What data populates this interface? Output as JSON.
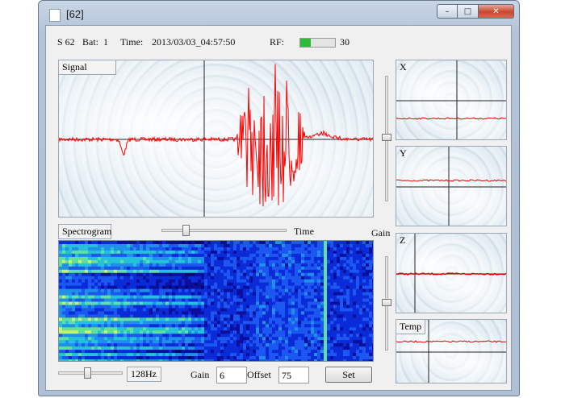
{
  "window": {
    "title": "[62]",
    "close_glyph": "✕",
    "maximize_glyph": "□",
    "minimize_glyph": "–"
  },
  "status": {
    "sensor": "S 62",
    "bat_label": "Bat:",
    "bat_value": "1",
    "time_label": "Time:",
    "time_value": "2013/03/03_04:57:50",
    "rf_label": "RF:",
    "rf_value": "30",
    "rf_level_percent": 30
  },
  "signal_panel": {
    "title": "Signal"
  },
  "side_panels": [
    {
      "title": "X"
    },
    {
      "title": "Y"
    },
    {
      "title": "Z"
    },
    {
      "title": "Temp"
    }
  ],
  "spectrogram": {
    "title": "Spectrogram",
    "time_label": "Time",
    "gain_label": "Gain"
  },
  "bottom": {
    "freq_label": "128Hz",
    "gain_label": "Gain",
    "gain_value": "6",
    "offset_label": "Offset",
    "offset_value": "75",
    "set_label": "Set"
  },
  "colors": {
    "trace": "#ff0000",
    "rf_fill": "#2dbb3a",
    "spectrogram_bg": "#0a0a8a"
  },
  "icons": [
    "app-icon",
    "minimize-icon",
    "maximize-icon",
    "close-icon"
  ]
}
